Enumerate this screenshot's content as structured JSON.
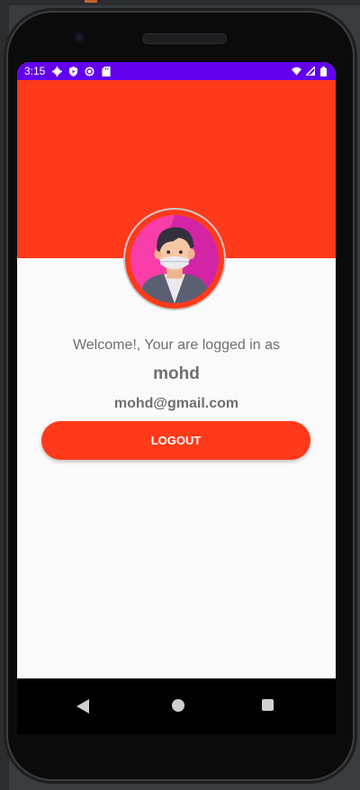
{
  "status_bar": {
    "time": "3:15",
    "left_icons": [
      "gear-icon",
      "shield-play-icon",
      "sync-icon",
      "sd-card-icon"
    ],
    "right_icons": [
      "wifi-icon",
      "signal-icon",
      "battery-icon"
    ],
    "color": "#6200ee"
  },
  "colors": {
    "accent": "#ff3a1a",
    "background": "#fafafa",
    "text": "#6f6f6f"
  },
  "profile": {
    "avatar_icon": "user-avatar-mask-icon",
    "welcome_text": "Welcome!, Your are logged in as",
    "username": "mohd",
    "email": "mohd@gmail.com"
  },
  "actions": {
    "logout_label": "LOGOUT"
  },
  "navigation": {
    "back_icon": "back-triangle-icon",
    "home_icon": "home-circle-icon",
    "recents_icon": "recents-square-icon"
  }
}
